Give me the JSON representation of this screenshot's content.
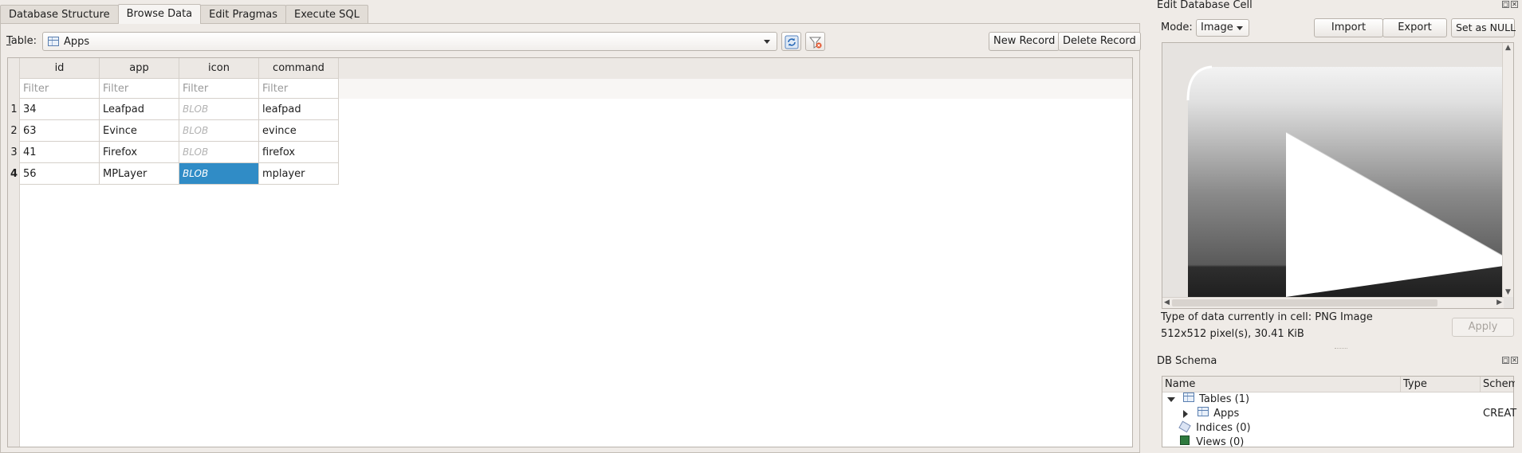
{
  "tabs": [
    {
      "label": "Database Structure",
      "active": false
    },
    {
      "label": "Browse Data",
      "active": true
    },
    {
      "label": "Edit Pragmas",
      "active": false
    },
    {
      "label": "Execute SQL",
      "active": false
    }
  ],
  "browse": {
    "table_label_prefix": "",
    "table_label_mnemonic": "T",
    "table_label_rest": "able:",
    "table_name": "Apps",
    "new_record": "New Record",
    "delete_record": "Delete Record",
    "refresh_icon": "refresh-icon",
    "clear_filters_icon": "clear-filters-icon"
  },
  "grid": {
    "columns": [
      "id",
      "app",
      "icon",
      "command"
    ],
    "filter_placeholder": "Filter",
    "rows": [
      {
        "num": "1",
        "cells": [
          "34",
          "Leafpad",
          "BLOB",
          "leafpad"
        ]
      },
      {
        "num": "2",
        "cells": [
          "63",
          "Evince",
          "BLOB",
          "evince"
        ]
      },
      {
        "num": "3",
        "cells": [
          "41",
          "Firefox",
          "BLOB",
          "firefox"
        ]
      },
      {
        "num": "4",
        "cells": [
          "56",
          "MPLayer",
          "BLOB",
          "mplayer"
        ]
      }
    ],
    "selected": {
      "row": 4,
      "column": "icon"
    }
  },
  "edit_cell": {
    "title": "Edit Database Cell",
    "mode_label": "Mode:",
    "mode_value": "Image",
    "import": "Import",
    "export": "Export",
    "set_null": "Set as NULL",
    "type_info": "Type of data currently in cell: PNG Image",
    "size_info": "512x512 pixel(s), 30.41 KiB",
    "apply": "Apply"
  },
  "schema": {
    "title": "DB Schema",
    "columns": [
      "Name",
      "Type",
      "Schem"
    ],
    "tree": {
      "tables": "Tables (1)",
      "apps": "Apps",
      "apps_schema": "CREAT",
      "indices": "Indices (0)",
      "views": "Views (0)"
    }
  },
  "colors": {
    "selection": "#308cc6",
    "window_bg": "#efebe7"
  }
}
